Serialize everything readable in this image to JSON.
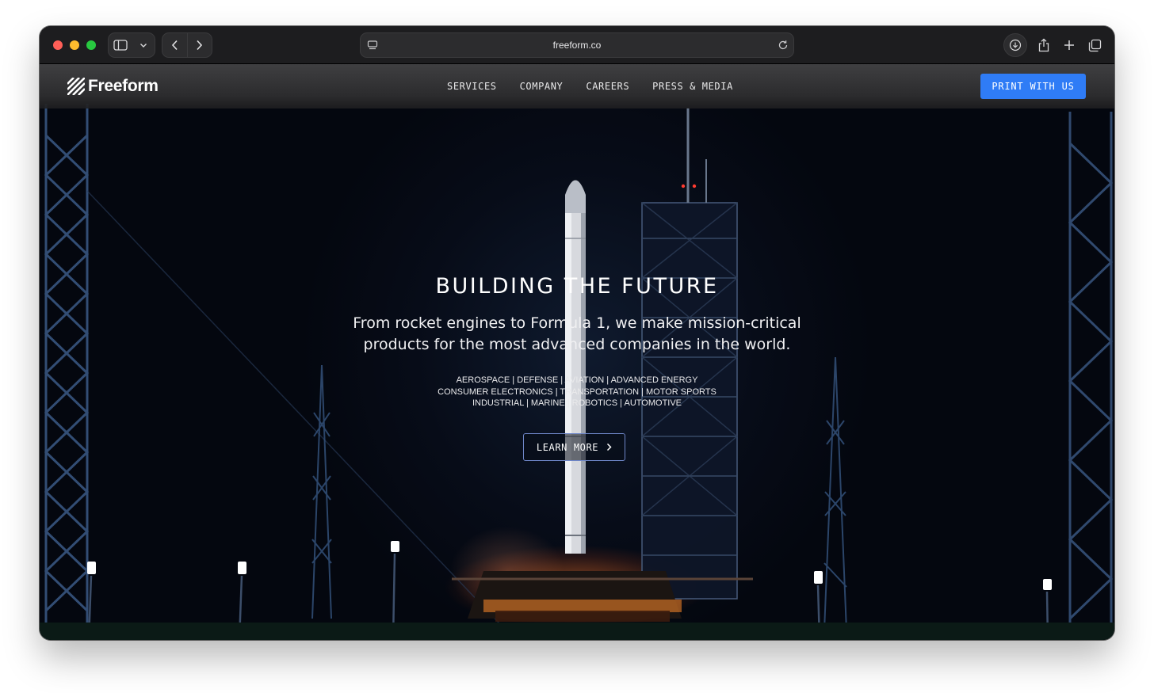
{
  "browser": {
    "url": "freeform.co",
    "icons": {
      "sidebar": "sidebar-icon",
      "back": "chevron-left-icon",
      "forward": "chevron-right-icon",
      "reload": "reload-icon",
      "download": "download-icon",
      "share": "share-icon",
      "new_tab": "plus-icon",
      "tabs": "tabs-icon"
    }
  },
  "site": {
    "brand": "Freeform",
    "nav": [
      "SERVICES",
      "COMPANY",
      "CAREERS",
      "PRESS & MEDIA"
    ],
    "cta": "PRINT WITH US",
    "accent_color": "#2f7cf6"
  },
  "hero": {
    "title": "BUILDING THE FUTURE",
    "subtitle_line1": "From rocket engines to Formula 1, we make mission-critical",
    "subtitle_line2": "products for the most advanced companies in the world.",
    "industries": [
      "AEROSPACE | DEFENSE | AVIATION | ADVANCED ENERGY",
      "CONSUMER ELECTRONICS | TRANSPORTATION | MOTOR SPORTS",
      "INDUSTRIAL | MARINE | ROBOTICS | AUTOMOTIVE"
    ],
    "button": "LEARN MORE"
  }
}
